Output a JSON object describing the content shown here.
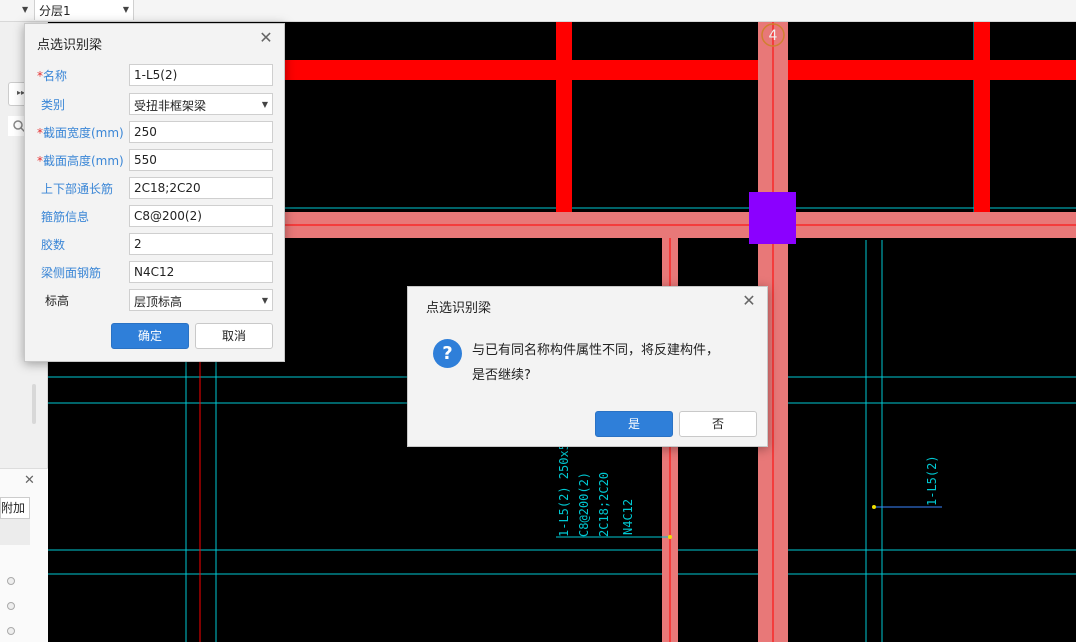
{
  "toolbar": {
    "layer_select": "分层1"
  },
  "left_panel": {
    "lower_tab_label": "附加"
  },
  "canvas": {
    "axis_marker": "4",
    "beam_annotation": [
      "1-L5(2) 250x550",
      "C8@200(2)",
      "2C18;2C20",
      "N4C12"
    ],
    "beam_label_right": "1-L5(2)"
  },
  "beam_dialog": {
    "title": "点选识别梁",
    "fields": [
      {
        "label": "名称",
        "required": true,
        "value": "1-L5(2)",
        "type": "text"
      },
      {
        "label": "类别",
        "required": false,
        "value": "受扭非框架梁",
        "type": "select"
      },
      {
        "label": "截面宽度(mm)",
        "required": true,
        "value": "250",
        "type": "text"
      },
      {
        "label": "截面高度(mm)",
        "required": true,
        "value": "550",
        "type": "text"
      },
      {
        "label": "上下部通长筋",
        "required": false,
        "value": "2C18;2C20",
        "type": "text"
      },
      {
        "label": "箍筋信息",
        "required": false,
        "value": "C8@200(2)",
        "type": "text"
      },
      {
        "label": "胶数",
        "required": false,
        "value": "2",
        "type": "text"
      },
      {
        "label": "梁侧面钢筋",
        "required": false,
        "value": "N4C12",
        "type": "text"
      },
      {
        "label": "标高",
        "required": false,
        "value": "层顶标高",
        "type": "select"
      }
    ],
    "ok_label": "确定",
    "cancel_label": "取消"
  },
  "confirm_dialog": {
    "title": "点选识别梁",
    "message_line1": "与已有同名称构件属性不同，将反建构件，",
    "message_line2": "是否继续?",
    "yes_label": "是",
    "no_label": "否"
  },
  "colors": {
    "beam_red": "#ff0000",
    "beam_highlight": "#e87878",
    "column_purple": "#8b00ff",
    "grid_cyan": "#00c8d2",
    "accent_blue": "#2f7fd9"
  }
}
